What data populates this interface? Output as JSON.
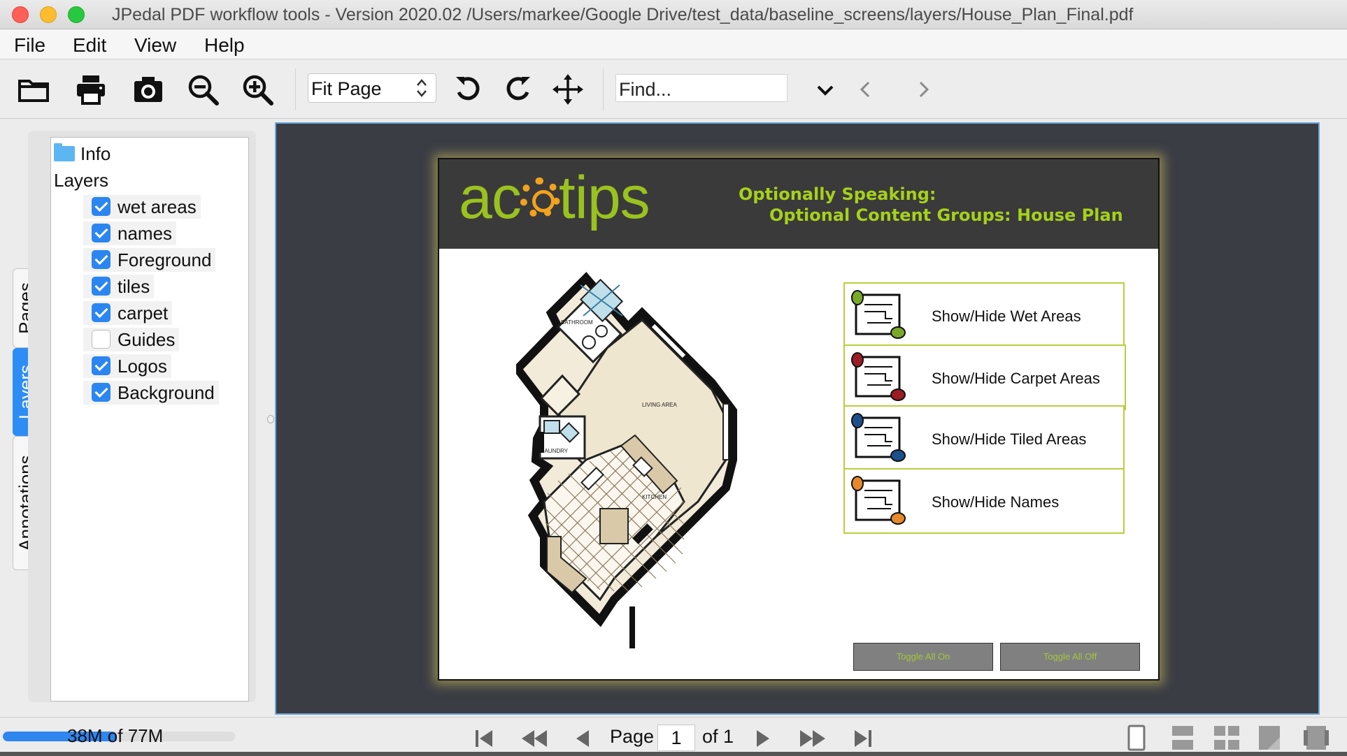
{
  "window": {
    "title": "JPedal PDF workflow tools - Version 2020.02 /Users/markee/Google Drive/test_data/baseline_screens/layers/House_Plan_Final.pdf"
  },
  "menu": {
    "items": [
      "File",
      "Edit",
      "View",
      "Help"
    ]
  },
  "toolbar": {
    "icons": [
      "open-folder-icon",
      "print-icon",
      "snapshot-icon",
      "zoom-out-icon",
      "zoom-in-icon",
      "rotate-left-icon",
      "rotate-right-icon",
      "pan-icon",
      "dropdown-icon",
      "previous-icon",
      "next-icon"
    ],
    "zoom_mode": "Fit Page",
    "find_placeholder": "Find..."
  },
  "side_tabs": {
    "items": [
      "Pages",
      "Layers",
      "Annotations"
    ],
    "active": "Layers"
  },
  "layers_panel": {
    "info_label": "Info",
    "layers_heading": "Layers",
    "layers": [
      {
        "label": "wet areas",
        "checked": true
      },
      {
        "label": "names",
        "checked": true
      },
      {
        "label": "Foreground",
        "checked": true
      },
      {
        "label": "tiles",
        "checked": true
      },
      {
        "label": "carpet",
        "checked": true
      },
      {
        "label": "Guides",
        "checked": false
      },
      {
        "label": "Logos",
        "checked": true
      },
      {
        "label": "Background",
        "checked": true
      }
    ]
  },
  "document": {
    "logo_text": "acrotips",
    "header_line1": "Optionally Speaking:",
    "header_line2": "Optional Content Groups:  House Plan",
    "plan_labels": {
      "bathroom": "BATHROOM",
      "living": "LIVING AREA",
      "laundry": "LAUNDRY",
      "kitchen": "KITCHEN"
    },
    "ocg_buttons": [
      {
        "label": "Show/Hide Wet Areas",
        "accent": "#7aa82a"
      },
      {
        "label": "Show/Hide Carpet Areas",
        "accent": "#9b1c24"
      },
      {
        "label": "Show/Hide Tiled Areas",
        "accent": "#1d4f8c"
      },
      {
        "label": "Show/Hide Names",
        "accent": "#e5892a"
      }
    ],
    "toggle_on": "Toggle All On",
    "toggle_off": "Toggle All Off"
  },
  "status": {
    "memory_text": "38M of 77M",
    "memory_used_fraction": 0.49,
    "page_label": "Page",
    "page_current": "1",
    "page_of": "of 1"
  },
  "colors": {
    "accent_blue": "#2e8df5",
    "viewer_bg": "#3b3d45",
    "header_green": "#a6d11a"
  }
}
